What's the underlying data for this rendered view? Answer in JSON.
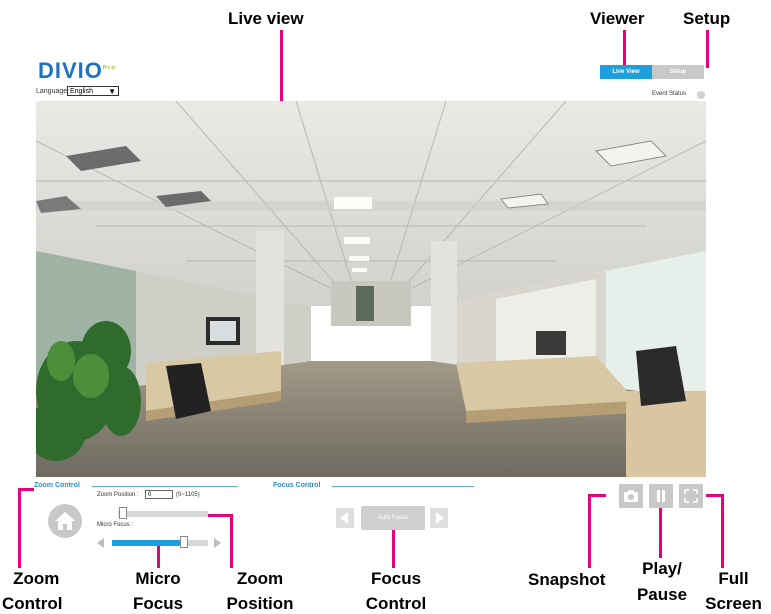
{
  "annotations": {
    "live_view": "Live view",
    "viewer": "Viewer",
    "setup": "Setup",
    "zoom_control": [
      "Zoom",
      "Control"
    ],
    "micro_focus": [
      "Micro",
      "Focus"
    ],
    "zoom_position": [
      "Zoom",
      "Position"
    ],
    "focus_control": [
      "Focus",
      "Control"
    ],
    "snapshot": "Snapshot",
    "play_pause": [
      "Play/",
      "Pause"
    ],
    "full_screen": [
      "Full",
      "Screen"
    ]
  },
  "header": {
    "logo": "DIVIO",
    "logo_suffix": "Pro",
    "language_label": "Language:",
    "language_value": "English",
    "live_view_button": "Live View",
    "setup_button": "Setup",
    "event_status": "Event Status"
  },
  "zoom_section": {
    "title": "Zoom Control",
    "position_label": "Zoom Position :",
    "position_value": "0",
    "position_range": "(0~1105)",
    "position_slider_level": 0.05,
    "micro_focus_label": "Micro Focus :",
    "micro_focus_level": 0.8
  },
  "focus_section": {
    "title": "Focus Control",
    "auto_focus_button": "Auto Focus"
  },
  "icons": {
    "home": "home-icon",
    "snapshot": "camera-icon",
    "pause": "pause-icon",
    "fullscreen": "fullscreen-icon"
  },
  "colors": {
    "accent": "#1ea0dc",
    "callout": "#e6007e",
    "brand": "#1e73be"
  }
}
